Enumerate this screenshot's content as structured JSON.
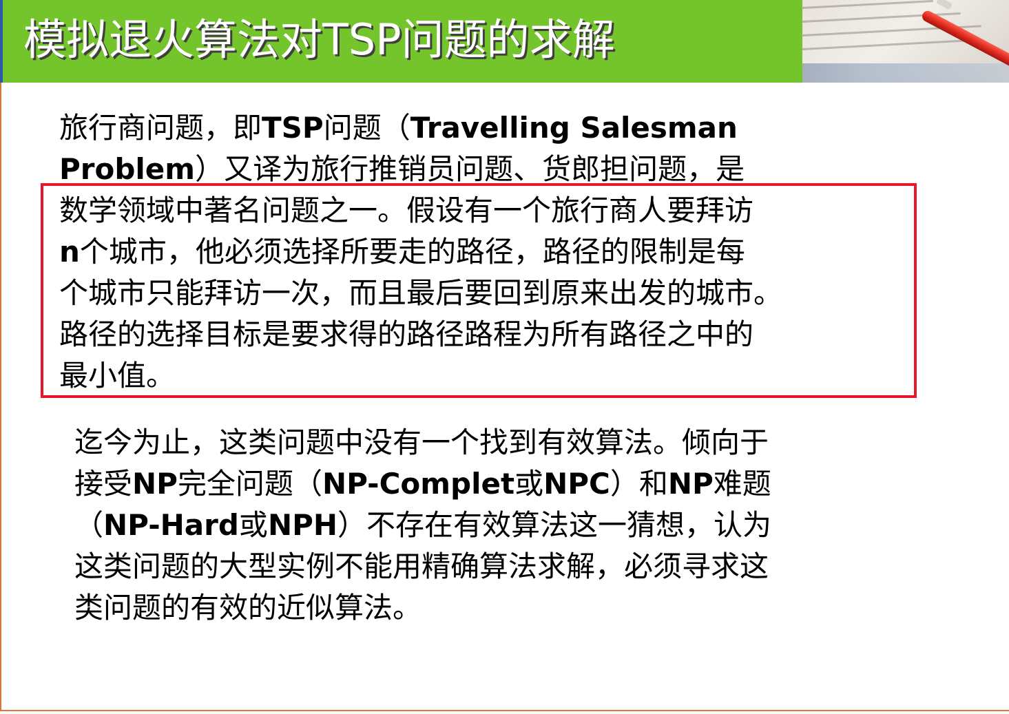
{
  "header": {
    "title": "模拟退火算法对TSP问题的求解",
    "bg_color": "#74c52b",
    "accent_color": "#2e57a8"
  },
  "paragraph1": {
    "lines": [
      [
        {
          "t": "旅行商问题，即",
          "b": false
        },
        {
          "t": "TSP",
          "b": true
        },
        {
          "t": "问题（",
          "b": false
        },
        {
          "t": "Travelling Salesman",
          "b": true
        }
      ],
      [
        {
          "t": "Problem",
          "b": true
        },
        {
          "t": "）又译为旅行推销员问题、货郎担问题，是",
          "b": false
        }
      ],
      [
        {
          "t": "数学领域中著名问题之一。假设有一个旅行商人要拜访",
          "b": false
        }
      ],
      [
        {
          "t": "n",
          "b": true
        },
        {
          "t": "个城市，他必须选择所要走的路径，路径的限制是每",
          "b": false
        }
      ],
      [
        {
          "t": "个城市只能拜访一次，而且最后要回到原来出发的城市。",
          "b": false
        }
      ],
      [
        {
          "t": "路径的选择目标是要求得的路径路程为所有路径之中的",
          "b": false
        }
      ],
      [
        {
          "t": "最小值。",
          "b": false
        }
      ]
    ]
  },
  "paragraph2": {
    "lines": [
      [
        {
          "t": "迄今为止，这类问题中没有一个找到有效算法。倾向于",
          "b": false
        }
      ],
      [
        {
          "t": "接受",
          "b": false
        },
        {
          "t": "NP",
          "b": true
        },
        {
          "t": "完全问题（",
          "b": false
        },
        {
          "t": "NP-Complet",
          "b": true
        },
        {
          "t": "或",
          "b": false
        },
        {
          "t": "NPC",
          "b": true
        },
        {
          "t": "）和",
          "b": false
        },
        {
          "t": "NP",
          "b": true
        },
        {
          "t": "难题",
          "b": false
        }
      ],
      [
        {
          "t": "（",
          "b": false
        },
        {
          "t": "NP-Hard",
          "b": true
        },
        {
          "t": "或",
          "b": false
        },
        {
          "t": "NPH",
          "b": true
        },
        {
          "t": "）不存在有效算法这一猜想，认为",
          "b": false
        }
      ],
      [
        {
          "t": "这类问题的大型实例不能用精确算法求解，必须寻求这",
          "b": false
        }
      ],
      [
        {
          "t": "类问题的有效的近似算法。",
          "b": false
        }
      ]
    ]
  },
  "highlight": {
    "color": "#e41a2a"
  }
}
